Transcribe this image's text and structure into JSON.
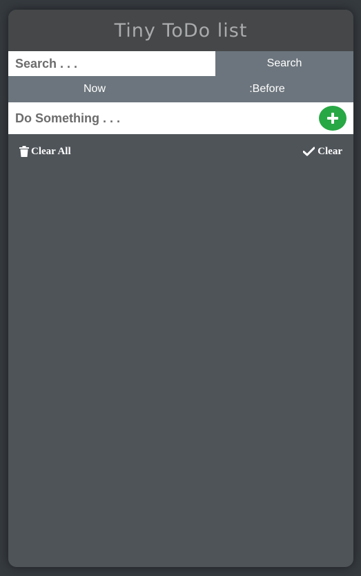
{
  "app": {
    "title": "Tiny ToDo list"
  },
  "search": {
    "placeholder": "Search . . .",
    "value": "",
    "button_label": "Search"
  },
  "filters": {
    "tabs": [
      {
        "label": "Now"
      },
      {
        "label": ":Before"
      }
    ]
  },
  "new_task": {
    "placeholder": "Do Something . . .",
    "value": "",
    "add_icon": "plus-icon"
  },
  "actions": {
    "clear_all_label": "Clear All",
    "clear_all_icon": "trash-icon",
    "clear_label": "Clear",
    "clear_icon": "check-icon"
  },
  "colors": {
    "accent_green": "#28a745",
    "tab_gray": "#6c757d",
    "panel_bg": "#4f5459",
    "header_bg": "#454748"
  }
}
